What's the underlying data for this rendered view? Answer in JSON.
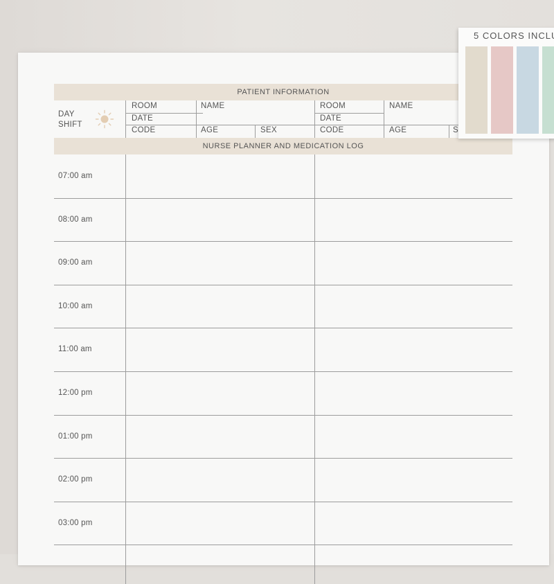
{
  "header": {
    "patient_information": "PATIENT INFORMATION",
    "nurse_planner_title": "NURSE PLANNER AND MEDICATION LOG"
  },
  "shift": {
    "line1": "DAY",
    "line2": "SHIFT",
    "icon": "sun-icon"
  },
  "patient_fields": {
    "room": "ROOM",
    "name": "NAME",
    "date": "DATE",
    "code": "CODE",
    "age": "AGE",
    "sex": "SEX",
    "sex_partial": "S"
  },
  "times": [
    "07:00 am",
    "08:00 am",
    "09:00 am",
    "10:00 am",
    "11:00 am",
    "12:00 pm",
    "01:00 pm",
    "02:00 pm",
    "03:00 pm"
  ],
  "swatch_card": {
    "title": "5 COLORS INCLU",
    "colors": [
      "#e2dbcd",
      "#e6c8c6",
      "#c8d8e2",
      "#c6dfd1"
    ]
  },
  "colors": {
    "header_bar": "#e9e1d6",
    "sun_icon": "#e3cdb3",
    "lines": "#9c9c9c",
    "paper": "#f8f8f7"
  }
}
